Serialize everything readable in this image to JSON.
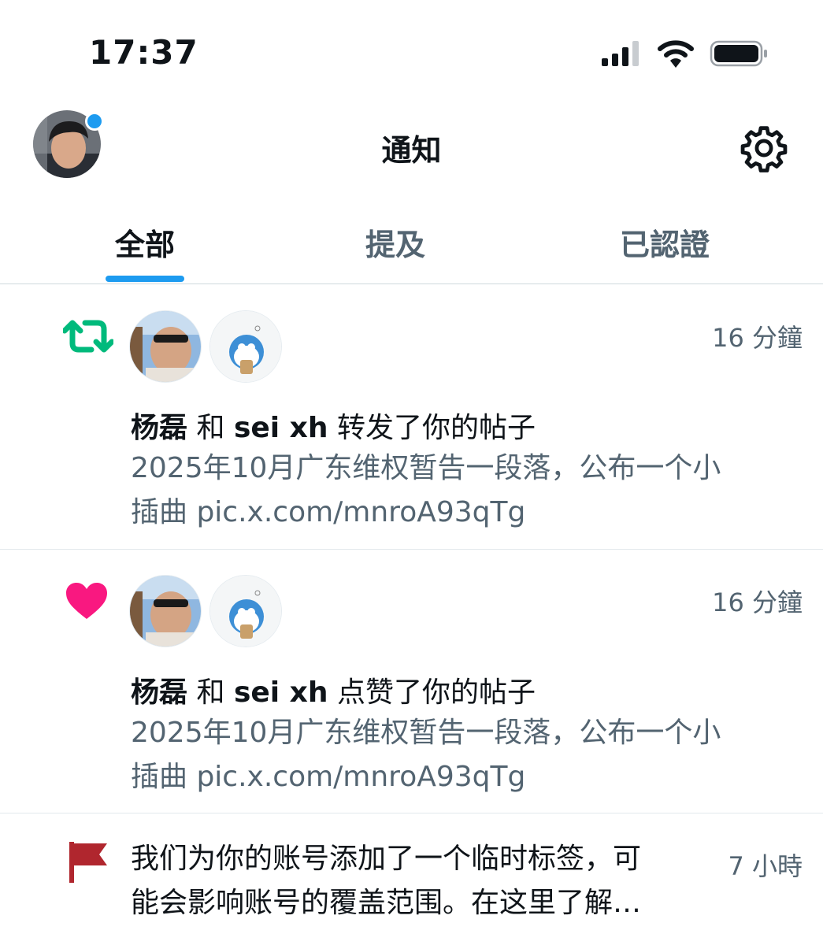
{
  "status_bar": {
    "time": "17:37",
    "icons": [
      "cellular-signal-icon",
      "wifi-icon",
      "battery-icon"
    ]
  },
  "header": {
    "title": "通知",
    "avatar": "profile-avatar",
    "settings_icon": "gear-icon"
  },
  "tabs": [
    {
      "label": "全部",
      "active": true
    },
    {
      "label": "提及",
      "active": false
    },
    {
      "label": "已認證",
      "active": false
    }
  ],
  "colors": {
    "accent": "#1d9bf0",
    "retweet": "#00ba7c",
    "like": "#f91880",
    "flag": "#b0262e",
    "secondary_text": "#536471"
  },
  "notifications": [
    {
      "type_icon": "retweet-icon",
      "user1": "杨磊",
      "conj": "和",
      "user2": "sei xh",
      "action": "转发了你的帖子",
      "time": "16 分鐘",
      "preview_line1": "2025年10月广东维权暂告一段落，公布一个小",
      "preview_line2": "插曲 pic.x.com/mnroA93qTg"
    },
    {
      "type_icon": "heart-icon",
      "user1": "杨磊",
      "conj": "和",
      "user2": "sei xh",
      "action": "点赞了你的帖子",
      "time": "16 分鐘",
      "preview_line1": "2025年10月广东维权暂告一段落，公布一个小",
      "preview_line2": "插曲 pic.x.com/mnroA93qTg"
    },
    {
      "type_icon": "flag-icon",
      "text_line1": "我们为你的账号添加了一个临时标签，可",
      "text_line2": "能会影响账号的覆盖范围。在这里了解…",
      "time": "7 小時"
    }
  ]
}
